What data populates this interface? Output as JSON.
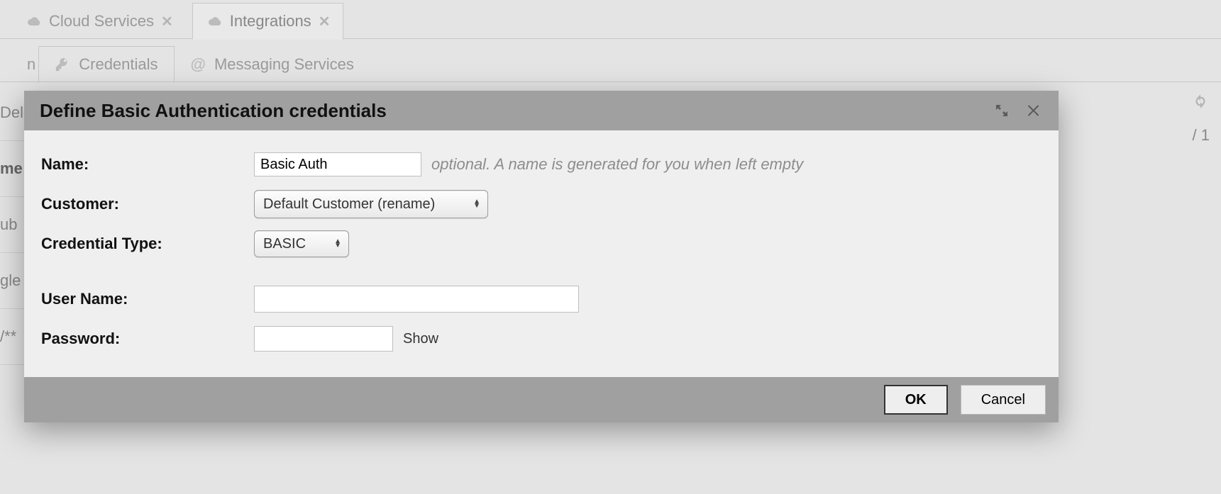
{
  "top_tabs": {
    "cloud_services": "Cloud Services",
    "integrations": "Integrations"
  },
  "sub_tabs": {
    "leading_fragment": "n",
    "credentials": "Credentials",
    "messaging_services": "Messaging Services"
  },
  "background_rows": {
    "r0": "Dele",
    "r1": "me",
    "r2": "ub",
    "r3": "gle",
    "r4": "/**"
  },
  "pagination_fragment": "/ 1",
  "dialog": {
    "title": "Define Basic Authentication credentials",
    "labels": {
      "name": "Name:",
      "customer": "Customer:",
      "credential_type": "Credential Type:",
      "username": "User Name:",
      "password": "Password:"
    },
    "values": {
      "name": "Basic Auth",
      "customer": "Default Customer (rename)",
      "credential_type": "BASIC",
      "username": "",
      "password": ""
    },
    "hints": {
      "name": "optional. A name is generated for you when left empty"
    },
    "show_link": "Show",
    "buttons": {
      "ok": "OK",
      "cancel": "Cancel"
    }
  }
}
